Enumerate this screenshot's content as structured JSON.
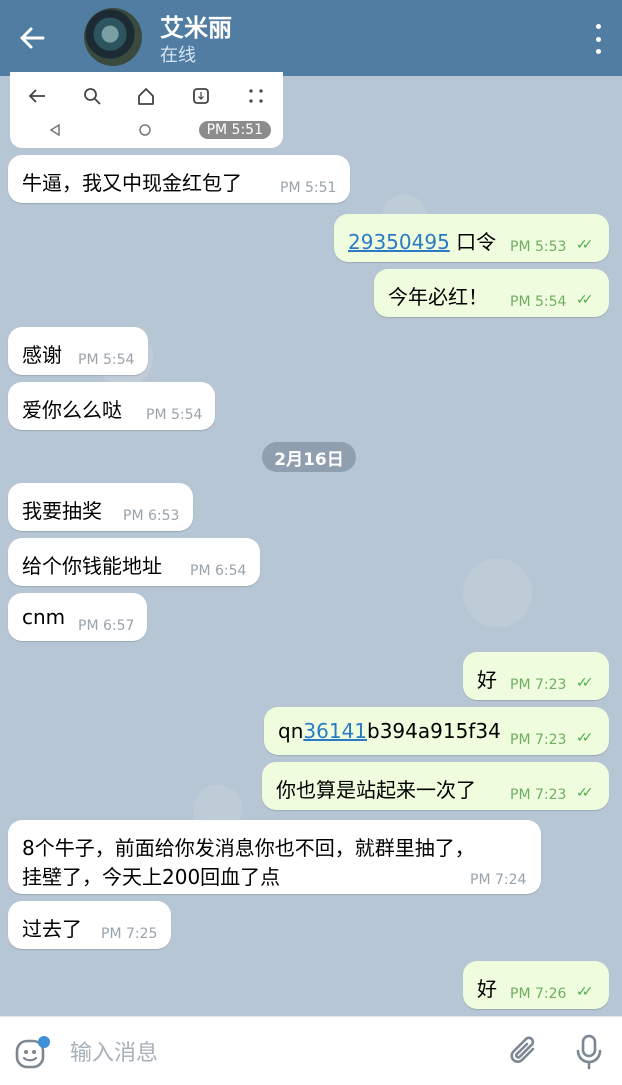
{
  "header": {
    "title": "艾米丽",
    "status": "在线",
    "back_icon": "arrow-left-icon",
    "menu_icon": "more-vertical-icon"
  },
  "screenshot_message": {
    "time": "PM 5:51"
  },
  "messages": [
    {
      "dir": "in",
      "text": "牛逼，我又中现金红包了",
      "time": "PM 5:51"
    },
    {
      "dir": "out",
      "link": "29350495",
      "text": " 口令",
      "time": "PM 5:53"
    },
    {
      "dir": "out",
      "text": "今年必红！",
      "time": "PM 5:54"
    },
    {
      "dir": "in",
      "text": "感谢",
      "time": "PM 5:54"
    },
    {
      "dir": "in",
      "text": "爱你么么哒",
      "time": "PM 5:54"
    },
    {
      "dir": "in",
      "text": "我要抽奖",
      "time": "PM 6:53"
    },
    {
      "dir": "in",
      "text": "给个你钱能地址",
      "time": "PM 6:54"
    },
    {
      "dir": "in",
      "text": "cnm",
      "time": "PM 6:57"
    },
    {
      "dir": "out",
      "text": "好",
      "time": "PM 7:23"
    },
    {
      "dir": "out",
      "prefix": "qn",
      "link": "36141",
      "text": "b394a915f34",
      "time": "PM 7:23"
    },
    {
      "dir": "out",
      "text": "你也算是站起来一次了",
      "time": "PM 7:23"
    },
    {
      "dir": "in",
      "line1": "8个牛子，前面给你发消息你也不回，就群里抽了，",
      "line2": "挂壁了，今天上200回血了点",
      "time": "PM 7:24"
    },
    {
      "dir": "in",
      "text": "过去了",
      "time": "PM 7:25"
    },
    {
      "dir": "out",
      "text": "好",
      "time": "PM 7:26"
    }
  ],
  "date_separator": "2月16日",
  "composer": {
    "placeholder": "输入消息",
    "emoji_icon": "sticker-icon",
    "attach_icon": "paperclip-icon",
    "mic_icon": "microphone-icon"
  },
  "colors": {
    "header": "#517da2",
    "incoming_bubble": "#ffffff",
    "outgoing_bubble": "#effdde",
    "chat_background": "#b7c6d4",
    "link": "#2a7bc4",
    "read_checks": "#4fae4e"
  }
}
